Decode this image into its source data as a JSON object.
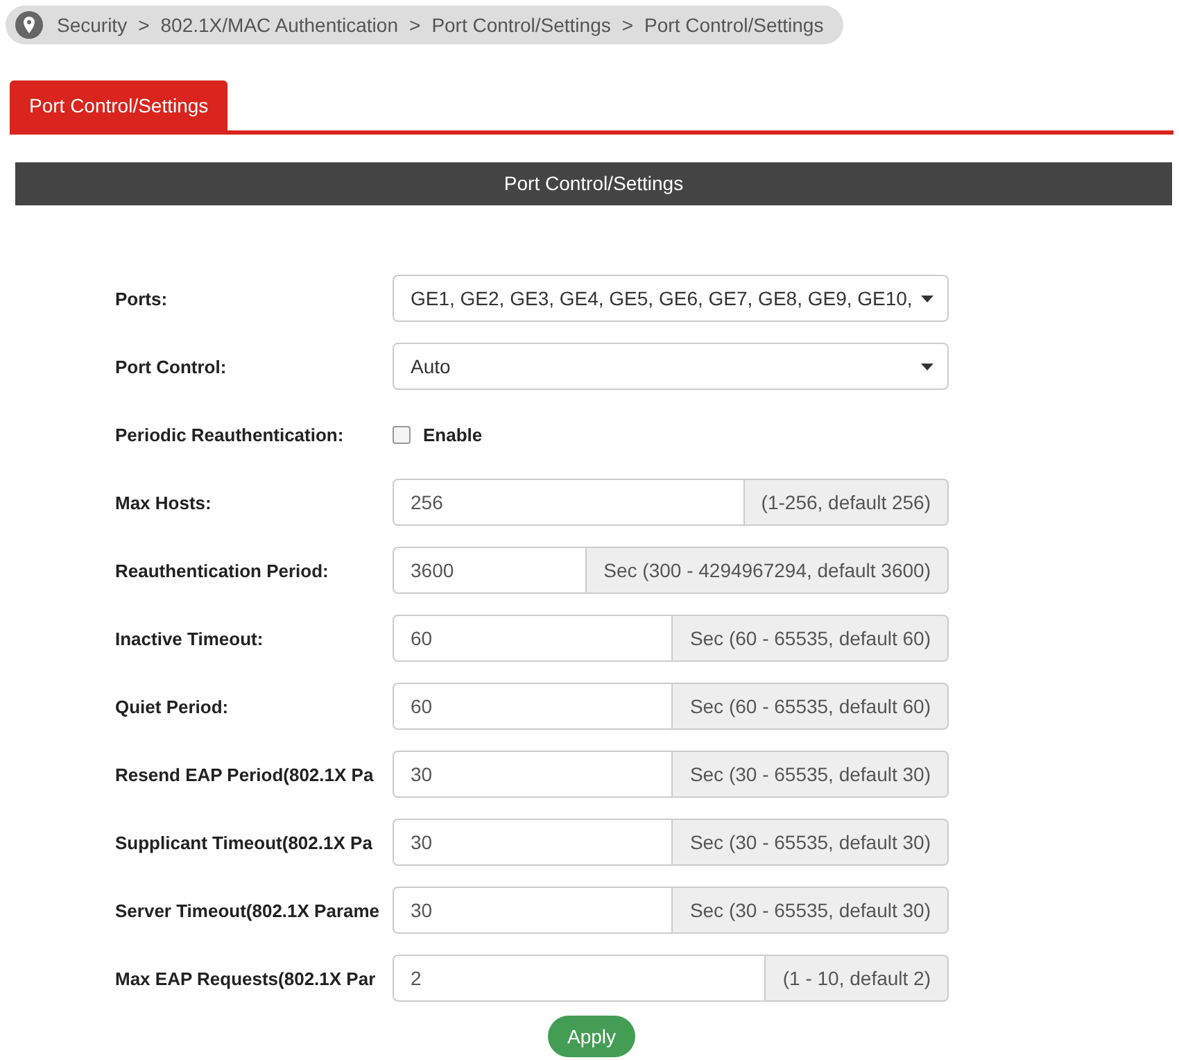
{
  "breadcrumb": [
    "Security",
    "802.1X/MAC Authentication",
    "Port Control/Settings",
    "Port Control/Settings"
  ],
  "breadcrumb_separator": ">",
  "tabs": [
    {
      "label": "Port Control/Settings",
      "selected": true
    }
  ],
  "panel_title": "Port Control/Settings",
  "fields": [
    {
      "kind": "select",
      "label": "Ports:",
      "value": "GE1, GE2, GE3, GE4, GE5, GE6, GE7, GE8, GE9, GE10,"
    },
    {
      "kind": "select",
      "label": "Port Control:",
      "value": "Auto"
    },
    {
      "kind": "checkbox",
      "label": "Periodic Reauthentication:",
      "option": "Enable",
      "checked": false
    },
    {
      "kind": "input",
      "label": "Max Hosts:",
      "value": "256",
      "hint": "(1-256, default 256)"
    },
    {
      "kind": "input",
      "label": "Reauthentication Period:",
      "value": "3600",
      "hint": "Sec (300 - 4294967294, default 3600)"
    },
    {
      "kind": "input",
      "label": "Inactive Timeout:",
      "value": "60",
      "hint": "Sec (60 - 65535, default 60)"
    },
    {
      "kind": "input",
      "label": "Quiet Period:",
      "value": "60",
      "hint": "Sec (60 - 65535, default 60)"
    },
    {
      "kind": "input",
      "label": "Resend EAP Period(802.1X Pa",
      "value": "30",
      "hint": "Sec (30 - 65535, default 30)"
    },
    {
      "kind": "input",
      "label": "Supplicant Timeout(802.1X Pa",
      "value": "30",
      "hint": "Sec (30 - 65535, default 30)"
    },
    {
      "kind": "input",
      "label": "Server Timeout(802.1X Parame",
      "value": "30",
      "hint": "Sec (30 - 65535, default 30)"
    },
    {
      "kind": "input",
      "label": "Max EAP Requests(802.1X Par",
      "value": "2",
      "hint": "(1 - 10, default 2)"
    }
  ],
  "apply_button": "Apply"
}
